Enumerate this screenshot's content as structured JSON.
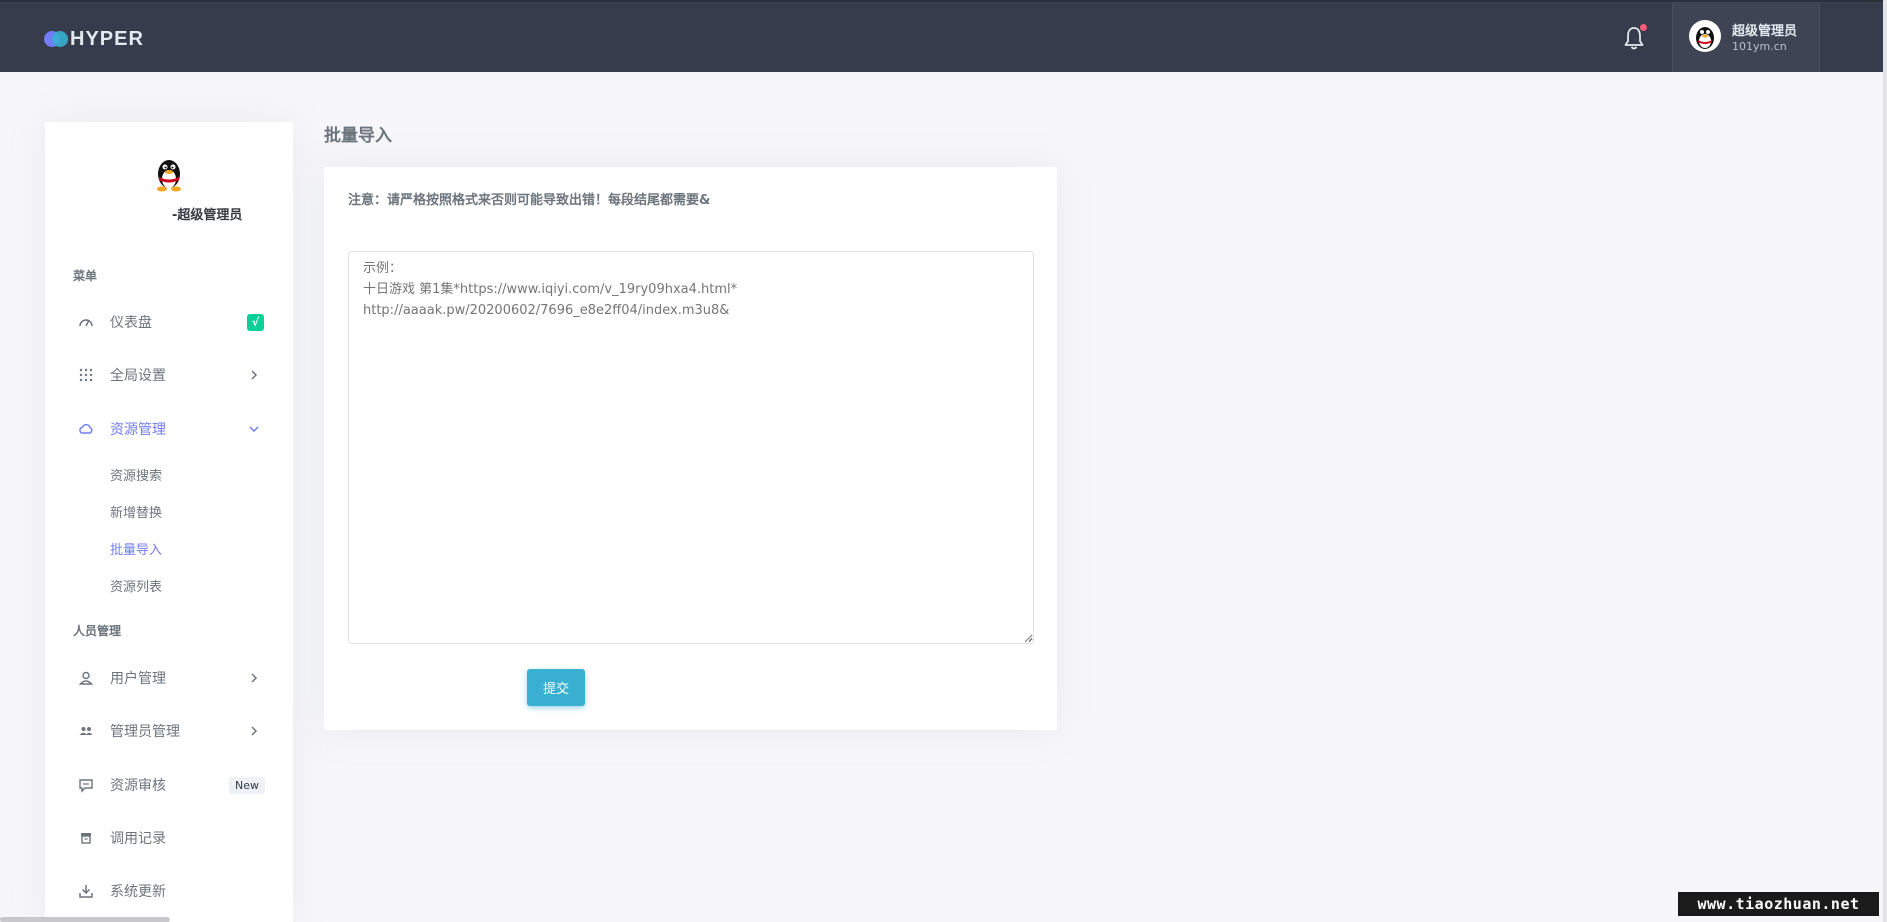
{
  "brand": {
    "name": "HYPER"
  },
  "topbar": {
    "user_name": "超级管理员",
    "user_sub": "101ym.cn",
    "notification_icon": "bell-icon"
  },
  "sidebar": {
    "user_label": "-超级管理员",
    "section_menu": "菜单",
    "section_people": "人员管理",
    "items": {
      "dashboard": {
        "label": "仪表盘",
        "icon": "speedometer-icon",
        "badge": "√"
      },
      "global_settings": {
        "label": "全局设置",
        "icon": "grid-icon"
      },
      "resource_mgmt": {
        "label": "资源管理",
        "icon": "cloud-icon"
      },
      "user_mgmt": {
        "label": "用户管理",
        "icon": "user-icon"
      },
      "admin_mgmt": {
        "label": "管理员管理",
        "icon": "users-icon"
      },
      "resource_review": {
        "label": "资源审核",
        "icon": "message-icon",
        "badge": "New"
      },
      "call_log": {
        "label": "调用记录",
        "icon": "archive-icon"
      },
      "system_update": {
        "label": "系统更新",
        "icon": "download-icon"
      }
    },
    "resource_sub": [
      "资源搜索",
      "新增替换",
      "批量导入",
      "资源列表"
    ]
  },
  "main": {
    "title": "批量导入",
    "notice": "注意：请严格按照格式来否则可能导致出错！每段结尾都需要&",
    "textarea_placeholder": "示例：\n十日游戏 第1集*https://www.iqiyi.com/v_19ry09hxa4.html*\nhttp://aaaak.pw/20200602/7696_e8e2ff04/index.m3u8&",
    "submit_label": "提交"
  },
  "watermark": "www.tiaozhuan.net",
  "colors": {
    "topbar": "#363c4b",
    "accent": "#727cf5",
    "info": "#39afd1",
    "success": "#0acf97"
  }
}
